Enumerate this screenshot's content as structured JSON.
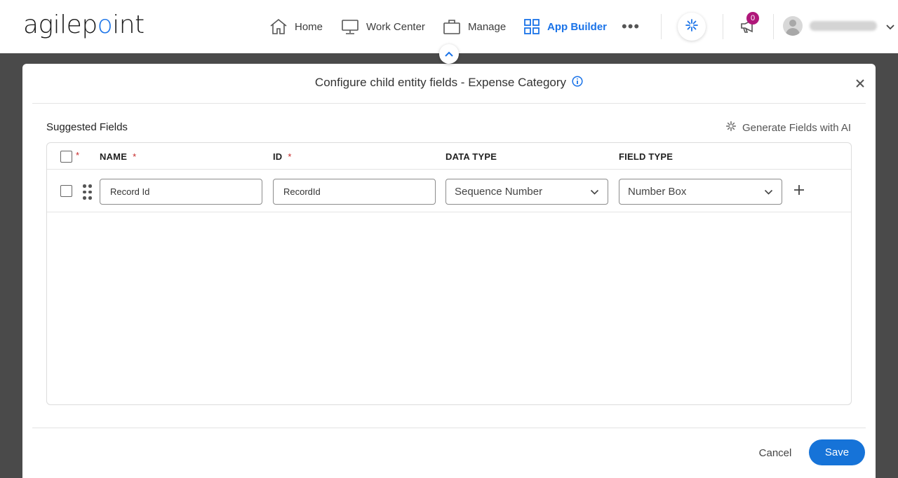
{
  "header": {
    "logo_text": "agilepoint",
    "nav": [
      {
        "label": "Home",
        "icon": "home-icon"
      },
      {
        "label": "Work Center",
        "icon": "monitor-icon"
      },
      {
        "label": "Manage",
        "icon": "briefcase-icon"
      },
      {
        "label": "App Builder",
        "icon": "grid-icon",
        "active": true
      }
    ],
    "more": "•••",
    "notifications_count": "0",
    "accent_color": "#1a73e8",
    "badge_color": "#b0177a"
  },
  "modal": {
    "title": "Configure child entity fields - Expense Category",
    "section_title": "Suggested Fields",
    "generate_ai_label": "Generate Fields with AI",
    "columns": {
      "required_mark": "*",
      "name": "NAME",
      "id": "ID",
      "data_type": "DATA TYPE",
      "field_type": "FIELD TYPE"
    },
    "rows": [
      {
        "name": "Record Id",
        "id": "RecordId",
        "data_type": "Sequence Number",
        "field_type": "Number Box"
      }
    ],
    "cancel_label": "Cancel",
    "save_label": "Save",
    "save_color": "#1673d8"
  }
}
